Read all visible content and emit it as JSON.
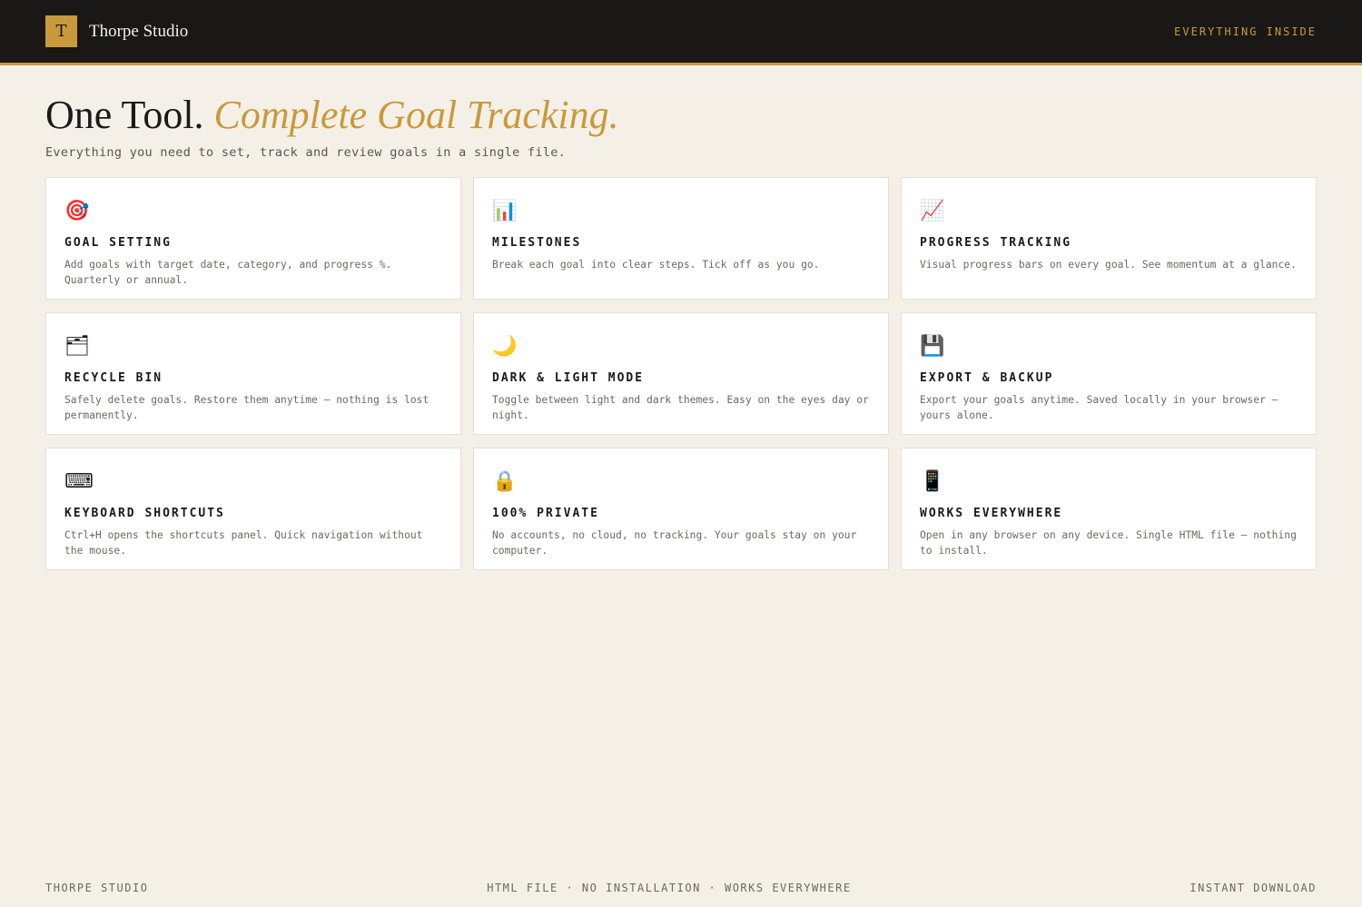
{
  "header": {
    "logo_letter": "T",
    "brand_name": "Thorpe Studio",
    "tagline": "EVERYTHING INSIDE"
  },
  "hero": {
    "title_main": "One Tool.",
    "title_accent": "Complete Goal Tracking.",
    "subtitle": "Everything you need to set, track and review goals in a single file."
  },
  "features": [
    {
      "icon": "🎯",
      "icon_name": "target-icon",
      "title": "GOAL SETTING",
      "desc": "Add goals with target date, category, and progress %. Quarterly or annual."
    },
    {
      "icon": "📊",
      "icon_name": "bar-chart-icon",
      "title": "MILESTONES",
      "desc": "Break each goal into clear steps. Tick off as you go."
    },
    {
      "icon": "📈",
      "icon_name": "trend-chart-icon",
      "title": "PROGRESS TRACKING",
      "desc": "Visual progress bars on every goal. See momentum at a glance."
    },
    {
      "icon": "🗂",
      "icon_name": "folder-icon",
      "title": "RECYCLE BIN",
      "desc": "Safely delete goals. Restore them anytime — nothing is lost permanently."
    },
    {
      "icon": "🌙",
      "icon_name": "moon-icon",
      "title": "DARK & LIGHT MODE",
      "desc": "Toggle between light and dark themes. Easy on the eyes day or night."
    },
    {
      "icon": "💾",
      "icon_name": "floppy-disk-icon",
      "title": "EXPORT & BACKUP",
      "desc": "Export your goals anytime. Saved locally in your browser — yours alone."
    },
    {
      "icon": "⌨",
      "icon_name": "keyboard-icon",
      "title": "KEYBOARD SHORTCUTS",
      "desc": "Ctrl+H opens the shortcuts panel. Quick navigation without the mouse."
    },
    {
      "icon": "🔒",
      "icon_name": "lock-icon",
      "title": "100% PRIVATE",
      "desc": "No accounts, no cloud, no tracking. Your goals stay on your computer."
    },
    {
      "icon": "📱",
      "icon_name": "device-icon",
      "title": "WORKS EVERYWHERE",
      "desc": "Open in any browser on any device. Single HTML file — nothing to install."
    }
  ],
  "footer": {
    "left": "THORPE STUDIO",
    "center": "HTML FILE · NO INSTALLATION · WORKS EVERYWHERE",
    "right": "INSTANT DOWNLOAD"
  },
  "colors": {
    "accent": "#c89a3c",
    "topbar": "#1a1816",
    "background": "#f4f0e8"
  }
}
